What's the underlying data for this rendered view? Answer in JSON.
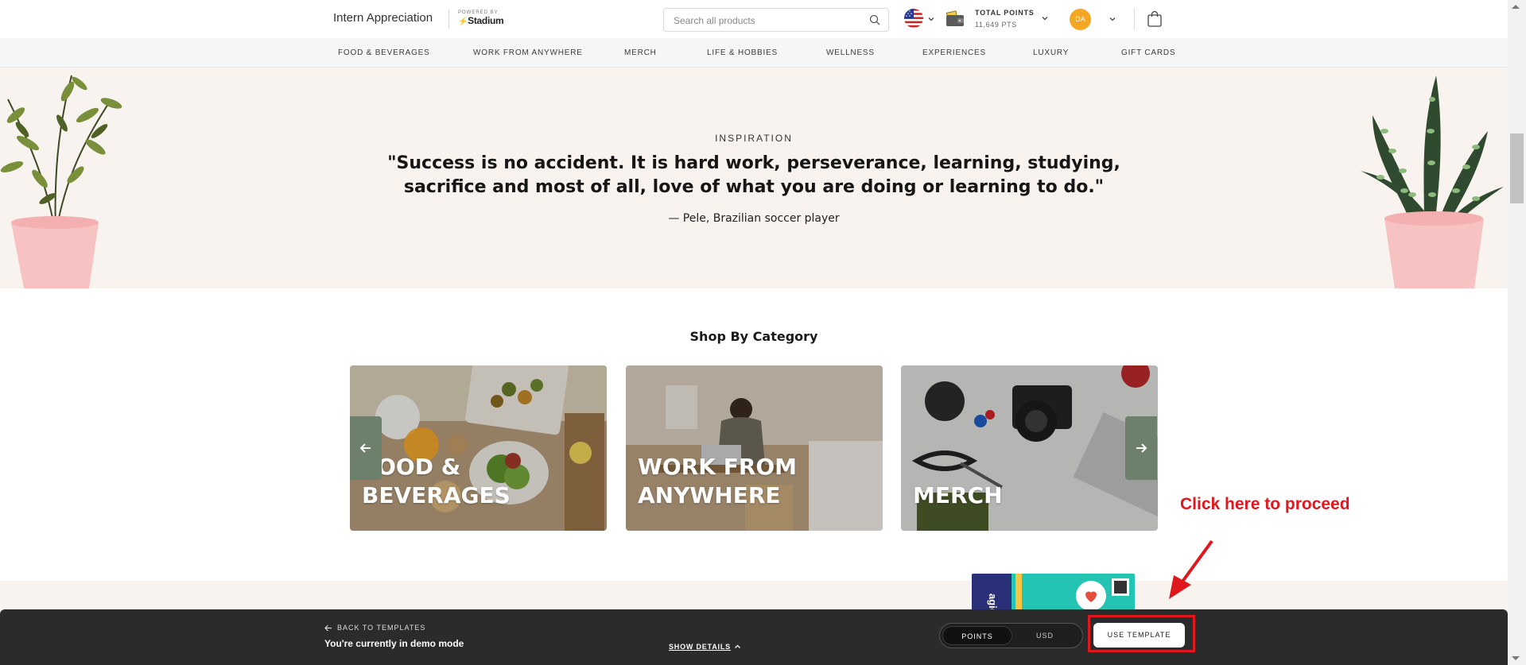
{
  "header": {
    "brand_name": "Intern Appreciation",
    "powered_by_label": "POWERED BY",
    "powered_by_name": "Stadium",
    "search_placeholder": "Search all products",
    "points_label": "TOTAL POINTS",
    "points_value": "11,649 PTS",
    "avatar_initials": "DA",
    "icons": [
      "search-icon",
      "us-flag-icon",
      "chevron-down-icon",
      "wallet-icon",
      "bag-icon"
    ]
  },
  "nav": {
    "items": [
      "FOOD & BEVERAGES",
      "WORK FROM ANYWHERE",
      "MERCH",
      "LIFE & HOBBIES",
      "WELLNESS",
      "EXPERIENCES",
      "LUXURY",
      "GIFT CARDS"
    ]
  },
  "inspiration": {
    "label": "INSPIRATION",
    "quote": "\"Success is no accident. It is hard work, perseverance, learning, studying, sacrifice and most of all, love of what you are doing or learning to do.\"",
    "author": "— Pele, Brazilian soccer player"
  },
  "shop": {
    "title": "Shop By Category",
    "categories": [
      {
        "label": "FOOD &\nBEVERAGES"
      },
      {
        "label": "WORK FROM\nANYWHERE"
      },
      {
        "label": "MERCH"
      }
    ]
  },
  "annotation": {
    "text": "Click here to proceed",
    "color": "#e0181e"
  },
  "demo_bar": {
    "back_label": "BACK TO TEMPLATES",
    "mode_text": "You're currently in demo mode",
    "show_details": "SHOW DETAILS",
    "toggle_points": "POINTS",
    "toggle_usd": "USD",
    "use_template": "USE TEMPLATE"
  },
  "colors": {
    "accent_green": "#6d806b",
    "avatar_orange": "#f5a623",
    "inspiration_bg": "#f8f3ee",
    "demo_bar_bg": "#2b2b2b"
  }
}
